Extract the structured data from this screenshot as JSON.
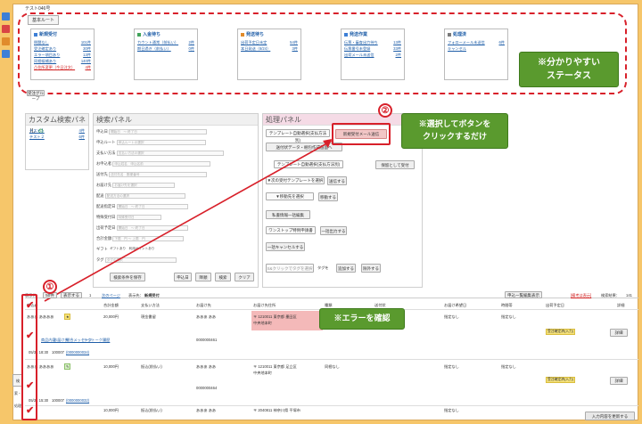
{
  "page": {
    "title": "テスト046号"
  },
  "status_area": {
    "tab_label": "基本ルート",
    "cards": [
      {
        "title": "新規受付",
        "color": "#3d7fd6",
        "rows": [
          {
            "label": "問題なし",
            "count": "101件"
          },
          {
            "label": "受注確定あり",
            "count": "30件"
          },
          {
            "label": "エラー項目あり",
            "count": "13件"
          },
          {
            "label": "同梱候補あり",
            "count": "140件"
          },
          {
            "label": "住所変更（今日注文）",
            "count": "4件",
            "warn": true
          }
        ]
      },
      {
        "title": "入金待ち",
        "color": "#41a35a",
        "rows": [
          {
            "label": "カウント通常（前払い）",
            "count": "2件"
          },
          {
            "label": "期日過ぎ（前払い）",
            "count": "0件"
          }
        ]
      },
      {
        "title": "発送待ち",
        "color": "#e08b2c",
        "rows": [
          {
            "label": "出荷予定日未定",
            "count": "54件"
          },
          {
            "label": "本日発送（6/24）",
            "count": "3件"
          }
        ]
      },
      {
        "title": "発送作業",
        "color": "#3d7fd6",
        "rows": [
          {
            "label": "伝票・審査出力待ち",
            "count": "13件"
          },
          {
            "label": "伝票番号未登録",
            "count": "33件"
          },
          {
            "label": "出荷メール未送信",
            "count": "2件"
          }
        ]
      },
      {
        "title": "処理済",
        "color": "#7a7a7a",
        "rows": [
          {
            "label": "フォローメール未送信",
            "count": "6件"
          },
          {
            "label": "キャンセル",
            "count": ""
          }
        ]
      }
    ],
    "below_label": "受注グループ"
  },
  "callouts": {
    "status": "※分かりやすい\nステータス",
    "button": "※選択してボタンを\nクリックするだけ",
    "error": "※エラーを確認",
    "num1": "①",
    "num2": "②"
  },
  "custom_panel": {
    "title": "カスタム検索パネル",
    "items": [
      {
        "label": "テスト１",
        "count": "4件"
      },
      {
        "label": "テスト２",
        "count": "6件"
      }
    ]
  },
  "search_panel": {
    "title": "検索パネル",
    "fields": [
      {
        "label": "申込日",
        "value": "開始日　〜 終了日"
      },
      {
        "label": "申込ルート",
        "value": "申込ルートの選択"
      },
      {
        "label": "支払い方法",
        "value": "支払い方法の選択"
      },
      {
        "label": "お申込者",
        "value": "申込姓名　申込名前"
      },
      {
        "label": "送付先",
        "value": "送付先名　郵便番号"
      },
      {
        "label": "お届け先",
        "value": "お届け先を選択"
      },
      {
        "label": "配送",
        "value": "配送方法の選択"
      },
      {
        "label": "配送指定日",
        "value": "開始日　〜 終了日"
      },
      {
        "label": "特殊受付日",
        "value": "特殊受付日"
      },
      {
        "label": "出荷予定日",
        "value": "開始日　〜 終了日"
      },
      {
        "label": "合計金額",
        "value": "下限　円 〜 上限　円"
      },
      {
        "label": "ギフト",
        "value": "ギフトあり　利用ポイントあり"
      },
      {
        "label": "タグ",
        "value": "タグの選択"
      }
    ],
    "search_btn": "検索",
    "clear_btn": "クリア",
    "save_btn": "検索条件を保存",
    "sort_label": "申込日",
    "order_label": "降順"
  },
  "process_panel": {
    "title": "処理パネル",
    "template_select": "テンプレート自動選択(支払方法別)",
    "send_btn": "新規受付メール送信",
    "btn_delivery": "送付状データ・梱包作成画面へ",
    "template_select2": "テンプレート自動選択(支払方法別)",
    "btn_receive": "保留として受付",
    "next_template": "▼次の受付テンプレートを選択",
    "btn_send2": "送信する",
    "btn_move": "▼移動先を選択",
    "btn_move_go": "移動する",
    "btn_print": "私書情報一括編集",
    "wonstop": "ワンストップ特例申請書",
    "btn_batch": "一括出力する",
    "btn_cancel": "一括キャンセルする",
    "tag_placeholder": "S&クリックでタグを選択",
    "tag_label": "タグを",
    "btn_tag_add": "追加する",
    "btn_tag_del": "除外する"
  },
  "list": {
    "count_label": "表示件",
    "count_value": "50件",
    "display_btn": "表示する",
    "pager": "1",
    "next_page": "次のページ",
    "display_label": "表示先：",
    "display_status": "新規受付",
    "bulk_btn": "申込一覧編集表示",
    "detail_link": "[備考は表示]",
    "total_label": "検索結果：",
    "total_value": "141",
    "headers": [
      "申込者",
      "合計金額",
      "支払い方法",
      "お届け先",
      "お届け先住所",
      "種類",
      "送付状",
      "お届け希望日",
      "時間帯",
      "出荷予定日",
      "詳細"
    ],
    "rows": [
      {
        "name": "あああ ああああ",
        "amount": "20,000円",
        "pay": "現金書留",
        "dest": "あああ ああ",
        "addr": "〒 1210011 東京都 墨田区",
        "addr2": "中央地本町",
        "type": "同梱なし",
        "wish": "指定なし",
        "time": "指定なし",
        "tag": "受注確定済(入力)",
        "id": "0000000461",
        "date": "05/31 18:30",
        "code": "100007",
        "code2": "(0000000034)"
      },
      {
        "name": "あああ ああああ",
        "amount": "10,000円",
        "pay": "振込(前払い)",
        "dest": "あああ ああ",
        "addr": "〒 1210011 東京都 足立区",
        "addr2": "中央地本町",
        "type": "同梱なし",
        "wish": "指定なし",
        "time": "指定なし",
        "tag": "受注確定済(入力)",
        "id": "0000000464",
        "date": "05/31 15:30",
        "code": "100007",
        "code2": "(0000000032)"
      },
      {
        "name": "あああ ああああ",
        "amount": "10,000円",
        "pay": "振込(前払い)",
        "dest": "あああ ああ",
        "addr": "〒 2040811 神奈川県 平塚市",
        "addr2": "",
        "type": "",
        "wish": "指定なし",
        "time": "指定なし",
        "tag": "",
        "id": "",
        "date": "",
        "code": "",
        "code2": ""
      }
    ],
    "links": [
      "商品内容",
      "お届け先",
      "問合メッセージ",
      "ラクトーク履歴"
    ],
    "detail_btn": "詳細",
    "side_label": "検索・処理",
    "update_btn": "入力内容を更新する"
  }
}
